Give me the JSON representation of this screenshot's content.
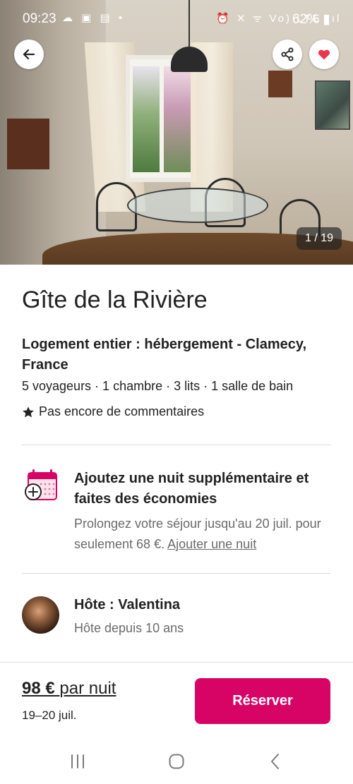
{
  "status_bar": {
    "time": "09:23",
    "left_icons": "☁ ▣ ▤ •",
    "right_icons": "⏰ ✕ ᯤ Vo) LTE .ıl",
    "battery": "62%"
  },
  "gallery": {
    "counter": "1 / 19",
    "back_icon": "arrow-left-icon",
    "share_icon": "share-icon",
    "favorite_icon": "heart-icon",
    "favorite_color": "#e8384f"
  },
  "listing": {
    "title": "Gîte de la Rivière",
    "type_line": "Logement entier : hébergement - Clamecy, France",
    "specs": "5 voyageurs · 1 chambre · 3 lits · 1 salle de bain",
    "rating_text": "Pas encore de commentaires"
  },
  "promo": {
    "icon": "calendar-add-icon",
    "title": "Ajoutez une nuit supplémentaire et faites des économies",
    "text": "Prolongez votre séjour jusqu'au 20 juil. pour seulement 68 €.",
    "link": "Ajouter une nuit"
  },
  "host": {
    "name": "Hôte : Valentina",
    "since": "Hôte depuis 10 ans"
  },
  "booking": {
    "price": "98 €",
    "per_night": "par nuit",
    "dates": "19–20 juil.",
    "reserve_label": "Réserver",
    "accent_color": "#d70466"
  }
}
